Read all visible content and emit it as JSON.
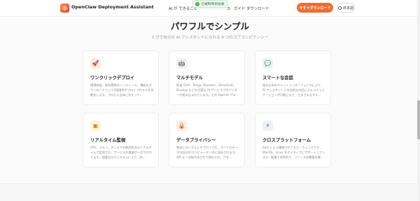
{
  "header": {
    "brand": "OpenClaw Deployment Assistant",
    "nav": [
      "AI が できること",
      "ス",
      "ガイド",
      "ダウンロード"
    ],
    "cta_label": "今すぐダウンロード",
    "lang_label": "日本語"
  },
  "toast": {
    "text": "已複制到剪貼板"
  },
  "section": {
    "title": "パワフルでシンプル",
    "subtitle": "3 分で自分の AI アシスタントになれる 6 つのコアコンピテンシー"
  },
  "cards": [
    {
      "title": "ワンクリックデプロイ",
      "desc": "環境検出、依存関係のインストール、構成のダウンロードという3段階のデプロイプロセスを自動化します。プロセス全体にわたって…",
      "icon": "rocket-icon"
    },
    {
      "title": "マルチモデル",
      "desc": "智谱 GLM、Tongyi Qianwen、DeepSeek、Doubao などの主要な AI サービスプロバイダーが組み込まれています。どの OpenAI プロト…",
      "icon": "robot-icon"
    },
    {
      "title": "スマートな会話",
      "desc": "組み込みのチャットインターフェイスにより、AI アシスタントとの自然な対話によるコミュニケーションが可能になり、さまざまなタス…",
      "icon": "chat-icon"
    },
    {
      "title": "リアルタイム監視",
      "desc": "CPU、メモリ、ディスクの使用状況はリアルタイムで監視され、サービスの健康が一目でわかります。強健なログシステムにより、問…",
      "icon": "monitor-icon"
    },
    {
      "title": "データプライバシー",
      "desc": "独自にローカルにデプロイされ、すべてのデータは自分のコンピューター内に保存されます。API キーは暗号化されて保存され、プラ…",
      "icon": "lock-icon"
    },
    {
      "title": "クロスプラットフォーム",
      "desc": "Rust により構築されており、ウィンドウズ、MacOS、Linux をネイティブにサポートしています。軽量で効率的で、リソース消費量を最…",
      "icon": "lightning-icon"
    }
  ],
  "colors": {
    "accent": "#f46b30",
    "toast_bg": "#f1fbf2"
  }
}
